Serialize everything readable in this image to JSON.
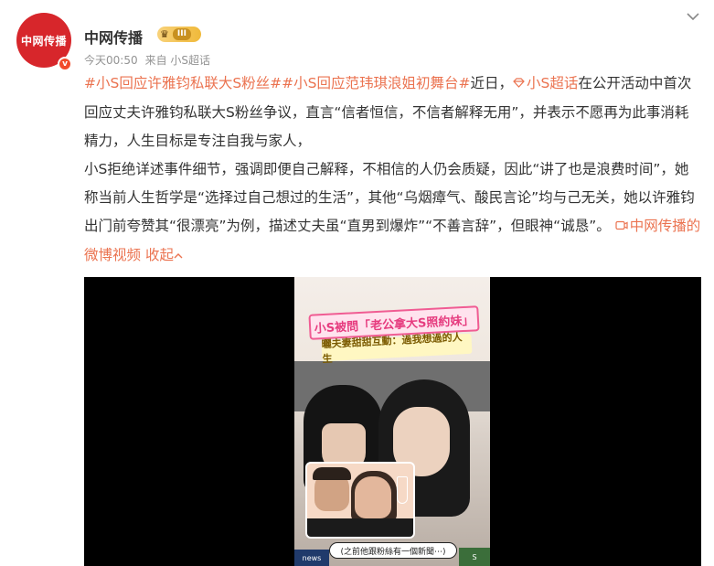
{
  "author": {
    "avatar_text": "中网传播",
    "verified_mark": "v",
    "name": "中网传播",
    "badge_level": "III"
  },
  "meta": {
    "time": "今天00:50",
    "source": "来自 小S超话"
  },
  "post": {
    "hashtag1": "#小S回应许雅钧私联大S粉丝#",
    "hashtag2": "#小S回应范玮琪浪姐初舞台#",
    "text1": "近日，",
    "mention": "小S超话",
    "text2": "在公开活动中首次回应丈夫许雅钧私联大S粉丝争议，直言“信者恒信，不信者解释无用”，并表示不愿再为此事消耗精力，人生目标是专注自我与家人，",
    "paragraph2": "小S拒绝详述事件细节，强调即便自己解释，不相信的人仍会质疑，因此“讲了也是浪费时间”，她称当前人生哲学是“选择过自己想过的生活”，其他“乌烟瘴气、酸民言论”均与己无关，她以许雅钧出门前夸赞其“很漂亮”为例，描述丈夫虽“直男到爆炸”“不善言辞”，但眼神“诚恳”。",
    "video_link": "中网传播的微博视频",
    "collapse": "收起"
  },
  "video": {
    "title_line1": "小S被問「老公拿大S照約妹」",
    "title_line2": "曬夫妻甜甜互動：過我想過的人生",
    "caption": "(之前他跟粉絲有一個新聞⋯)",
    "logo_left": "news",
    "logo_right": "S"
  },
  "colors": {
    "link": "#eb7350",
    "avatar": "#d7262b"
  },
  "icons": {
    "more": "chevron-down-icon",
    "super_topic": "diamond-icon",
    "video": "video-icon",
    "collapse": "chevron-up-icon"
  }
}
